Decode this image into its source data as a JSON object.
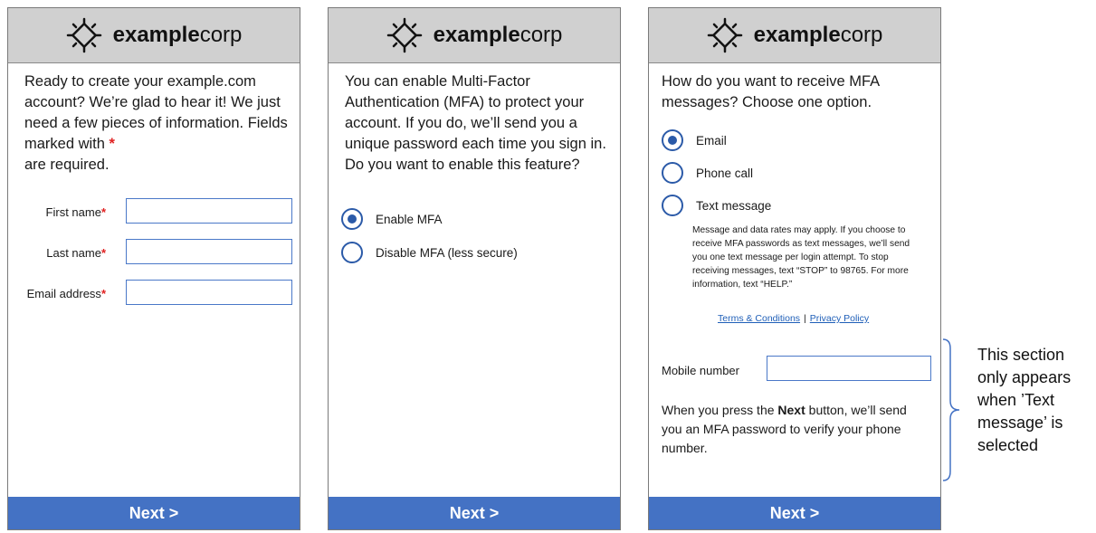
{
  "brand": {
    "bold": "example",
    "regular": "corp"
  },
  "required_marker": "*",
  "colors": {
    "header_bg": "#d0d0d0",
    "next_button": "#4472c4",
    "radio": "#2b5aa8",
    "required": "#e02020",
    "link": "#1f5fb8"
  },
  "screen1": {
    "intro_text": "Ready to create your example.com account? We’re glad to hear it! We just need a few pieces of information. Fields marked with ",
    "intro_suffix": "are required.",
    "fields": [
      {
        "label": "First name",
        "value": ""
      },
      {
        "label": "Last name",
        "value": ""
      },
      {
        "label": "Email address",
        "value": ""
      }
    ],
    "next_label": "Next >"
  },
  "screen2": {
    "intro_text": "You can enable Multi-Factor Authentication (MFA) to protect your account. If you do, we’ll send you a unique password each time you sign in. Do you want to enable this feature?",
    "options": [
      {
        "label": "Enable MFA",
        "selected": true
      },
      {
        "label": "Disable MFA (less secure)",
        "selected": false
      }
    ],
    "next_label": "Next >"
  },
  "screen3": {
    "intro_text": "How do you want to receive MFA messages? Choose one option.",
    "options": [
      {
        "label": "Email",
        "selected": true
      },
      {
        "label": "Phone call",
        "selected": false
      },
      {
        "label": "Text message",
        "selected": false
      }
    ],
    "disclaimer": "Message and data rates may apply. If you choose to receive MFA passwords as text messages, we’ll send you one text message per login attempt. To stop receiving messages, text “STOP” to 98765. For more information, text “HELP.”",
    "links": {
      "terms": "Terms & Conditions",
      "separator": "|",
      "privacy": "Privacy Policy"
    },
    "mobile_label": "Mobile number",
    "mobile_value": "",
    "note_prefix": "When you press the ",
    "note_bold": "Next",
    "note_suffix": " button, we’ll send you an MFA password to verify your phone number.",
    "next_label": "Next >"
  },
  "annotation": "This section only appears when ’Text message’ is selected"
}
